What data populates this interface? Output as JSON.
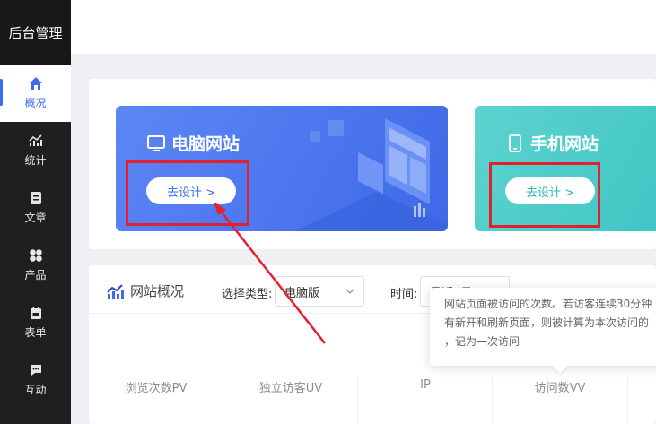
{
  "app": {
    "title": "后台管理"
  },
  "sidebar": {
    "items": [
      {
        "label": "概况",
        "icon": "home-icon",
        "active": true
      },
      {
        "label": "统计",
        "icon": "trend-chart-icon"
      },
      {
        "label": "文章",
        "icon": "article-icon"
      },
      {
        "label": "产品",
        "icon": "grid-icon"
      },
      {
        "label": "表单",
        "icon": "calendar-form-icon"
      },
      {
        "label": "互动",
        "icon": "chat-bubble-icon"
      }
    ]
  },
  "cards": {
    "pc": {
      "title": "电脑网站",
      "button": "去设计 >",
      "icon": "monitor-icon",
      "color": "#4a75ee"
    },
    "mobile": {
      "title": "手机网站",
      "button": "去设计 >",
      "icon": "mobile-phone-icon",
      "color": "#3fc5c4"
    }
  },
  "overview": {
    "title": "网站概况",
    "type_label": "选择类型:",
    "type_value": "电脑版",
    "time_label": "时间:",
    "time_value": "最近7日",
    "metrics": [
      "浏览次数PV",
      "独立访客UV",
      "IP",
      "访问数VV"
    ]
  },
  "tooltip": {
    "lines": [
      "网站页面被访问的次数。若访客连续30分钟",
      "有新开和刷新页面，则被计算为本次访问的",
      "，记为一次访问"
    ]
  },
  "colors": {
    "accent": "#3d6bf0",
    "highlight": "#e5202e",
    "sidebar": "#1f1f22"
  }
}
